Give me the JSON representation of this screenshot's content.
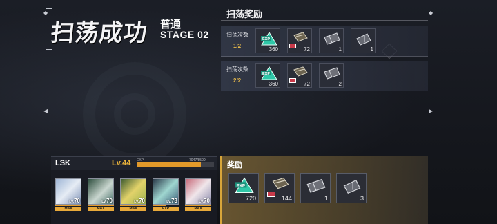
{
  "title": {
    "main": "扫荡成功",
    "mode": "普通",
    "stage": "STAGE 02"
  },
  "sweep_rewards": {
    "header": "扫荡奖励",
    "rows": [
      {
        "label": "扫荡次数",
        "count": "1/2",
        "items": [
          {
            "icon": "exp-crystal-icon",
            "qty": "360"
          },
          {
            "icon": "material-box-icon",
            "qty": "72"
          },
          {
            "icon": "mech-part-a-icon",
            "qty": "1"
          },
          {
            "icon": "mech-part-b-icon",
            "qty": "1"
          }
        ]
      },
      {
        "label": "扫荡次数",
        "count": "2/2",
        "items": [
          {
            "icon": "exp-crystal-icon",
            "qty": "360"
          },
          {
            "icon": "material-box-icon",
            "qty": "72"
          },
          {
            "icon": "mech-part-a-icon",
            "qty": "2"
          }
        ]
      }
    ]
  },
  "player": {
    "name": "LSK",
    "level": "Lv.44",
    "exp_label": "EXP",
    "exp_text": "7047/8500",
    "exp_progress": 0.829
  },
  "team": [
    {
      "lv_prefix": "Lv.",
      "lv": "70",
      "tag": "MAX",
      "tag_color": "#e8a93a"
    },
    {
      "lv_prefix": "Lv.",
      "lv": "70",
      "tag": "MAX",
      "tag_color": "#e8a93a"
    },
    {
      "lv_prefix": "Lv.",
      "lv": "70",
      "tag": "MAX",
      "tag_color": "#e8a93a"
    },
    {
      "lv_prefix": "Lv.",
      "lv": "73",
      "tag": "EXP",
      "tag_color": "#e8a93a"
    },
    {
      "lv_prefix": "Lv.",
      "lv": "70",
      "tag": "MAX",
      "tag_color": "#e8a93a"
    }
  ],
  "total_rewards": {
    "title": "奖励",
    "items": [
      {
        "icon": "exp-crystal-icon",
        "qty": "720"
      },
      {
        "icon": "material-box-icon",
        "qty": "144"
      },
      {
        "icon": "mech-part-a-icon",
        "qty": "1"
      },
      {
        "icon": "mech-part-b-icon",
        "qty": "3"
      }
    ]
  },
  "colors": {
    "accent_gold": "#e5b84a",
    "exp_teal": "#2fc7a8",
    "badge_red": "#c93a4a"
  }
}
